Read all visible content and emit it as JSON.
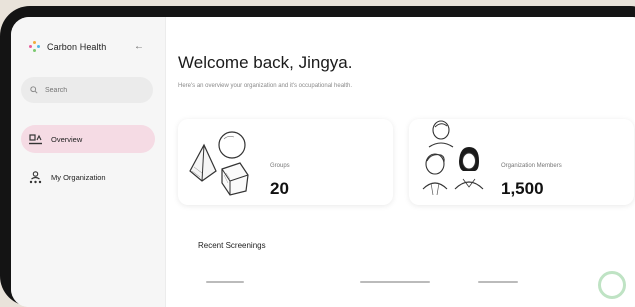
{
  "brand": {
    "name": "Carbon Health",
    "logo_colors": [
      "#e85d9b",
      "#f2a93b",
      "#4fb6e8",
      "#7bc96f"
    ]
  },
  "sidebar": {
    "collapse_icon": "chevron-left-icon",
    "search": {
      "placeholder": "Search",
      "value": ""
    },
    "items": [
      {
        "label": "Overview",
        "icon": "overview-icon",
        "active": true
      },
      {
        "label": "My Organization",
        "icon": "organization-icon",
        "active": false
      }
    ]
  },
  "header": {
    "title": "Welcome back, Jingya.",
    "subtitle": "Here's an overview your organization and it's occupational health."
  },
  "cards": {
    "groups": {
      "label": "Groups",
      "value": "20",
      "illustration": "3d-shapes-illustration"
    },
    "members": {
      "label": "Organization Members",
      "value": "1,500",
      "illustration": "people-sketch-illustration"
    }
  },
  "screenings": {
    "title": "Recent Screenings"
  },
  "colors": {
    "accent_active": "#f5dbe4",
    "background": "#ffffff",
    "sidebar_bg": "#f6f6f6",
    "bezel": "#141414"
  }
}
